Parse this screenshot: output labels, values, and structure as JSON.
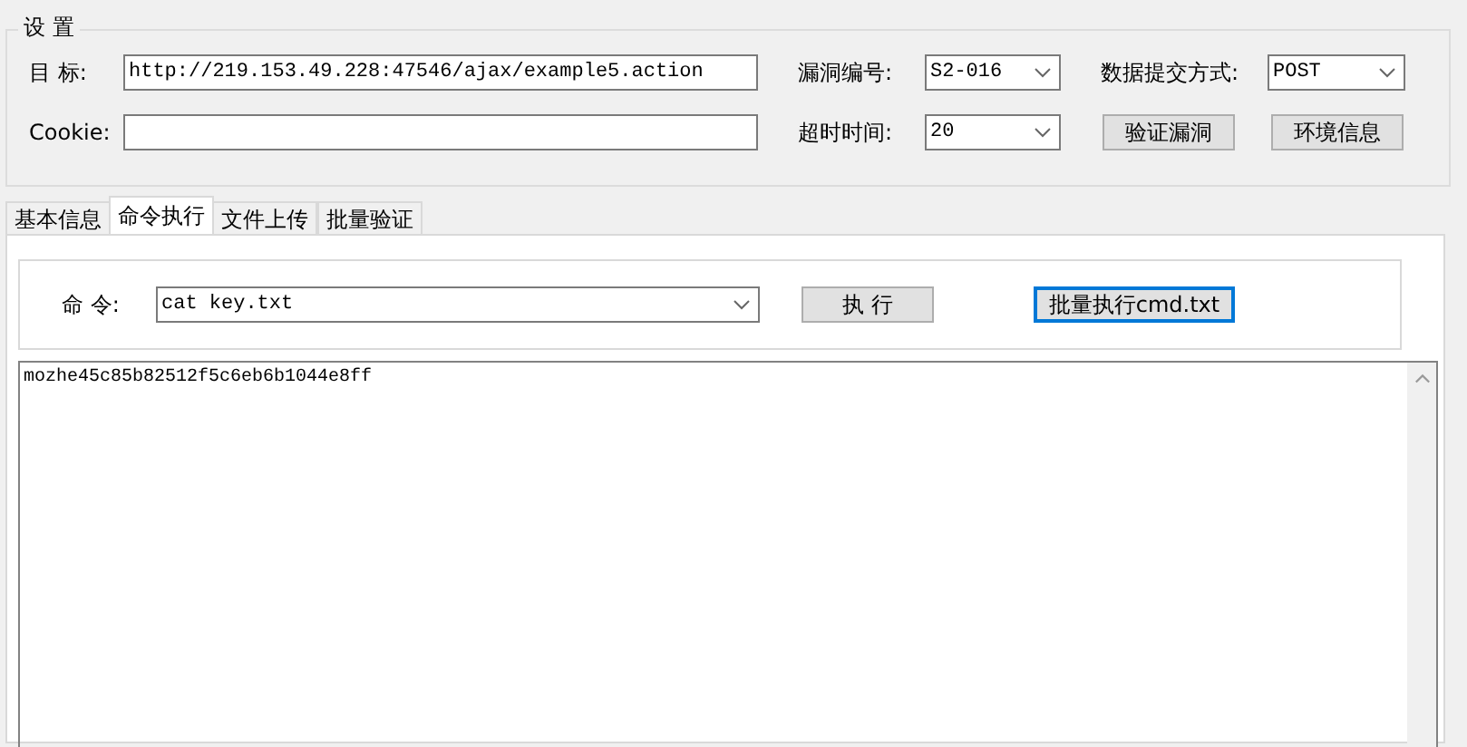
{
  "settings": {
    "title": "设 置",
    "target": {
      "label": "目  标:",
      "value": "http://219.153.49.228:47546/ajax/example5.action"
    },
    "cookie": {
      "label": "Cookie:"
    },
    "vuln_id": {
      "label": "漏洞编号:",
      "value": "S2-016"
    },
    "method": {
      "label": "数据提交方式:",
      "value": "POST"
    },
    "timeout": {
      "label": "超时时间:",
      "value": "20"
    },
    "buttons": [
      {
        "label": "验证漏洞",
        "focused": false
      },
      {
        "label": "环境信息",
        "focused": false
      }
    ]
  },
  "tabs": [
    {
      "label": "基本信息",
      "selected": false
    },
    {
      "label": "命令执行",
      "selected": true
    },
    {
      "label": "文件上传",
      "selected": false
    },
    {
      "label": "批量验证",
      "selected": false
    }
  ],
  "command": {
    "label": "命 令:",
    "value": "cat key.txt",
    "buttons": [
      {
        "label": "执 行",
        "focused": false
      },
      {
        "label": "批量执行cmd.txt",
        "focused": true
      }
    ]
  },
  "output": {
    "text": "mozhe45c85b82512f5c6eb6b1044e8ff"
  }
}
